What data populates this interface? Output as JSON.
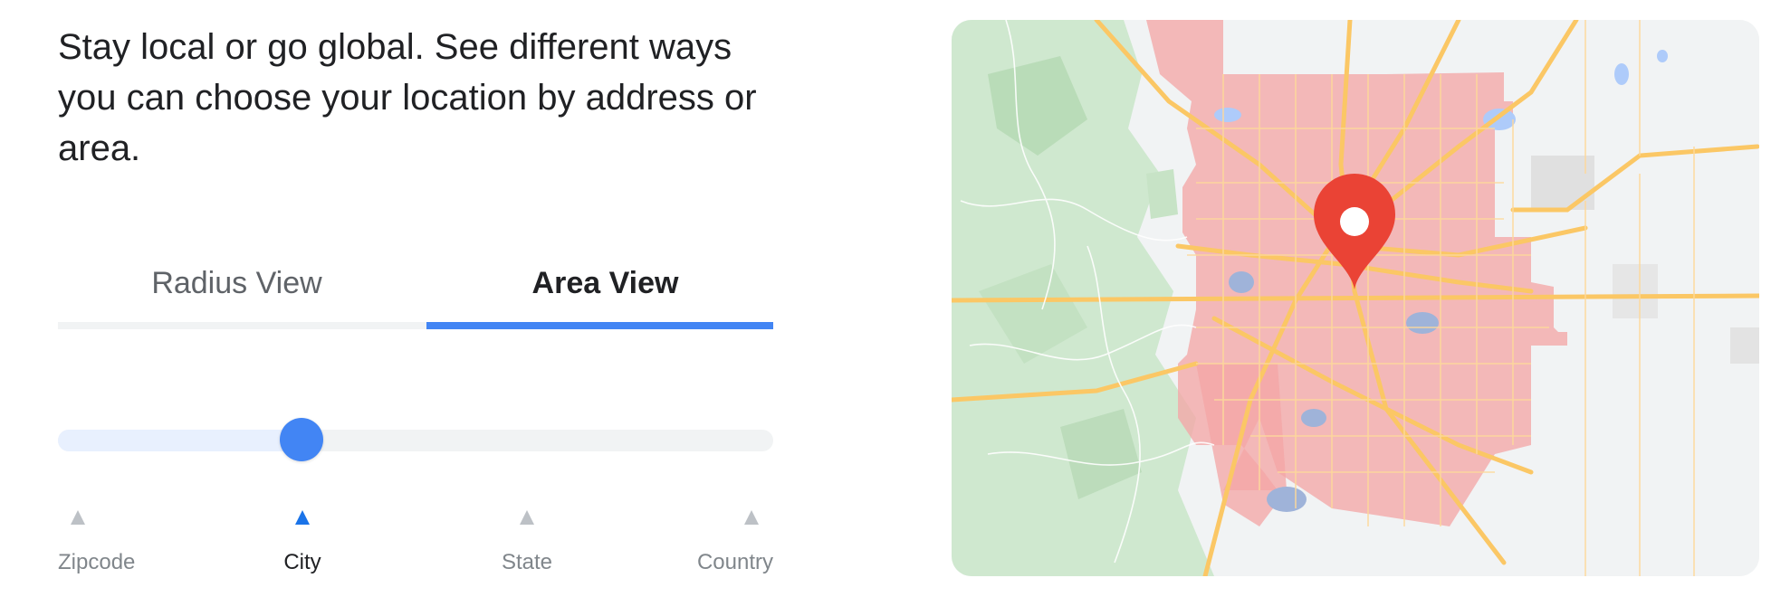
{
  "intro": {
    "text": "Stay local or go global. See different ways you can choose your location by address or area."
  },
  "tabs": [
    {
      "label": "Radius View",
      "selected": false
    },
    {
      "label": "Area View",
      "selected": true
    }
  ],
  "slider": {
    "value_fraction": 0.34,
    "stops": [
      {
        "label": "Zipcode",
        "active": false
      },
      {
        "label": "City",
        "active": true
      },
      {
        "label": "State",
        "active": false
      },
      {
        "label": "Country",
        "active": false
      }
    ]
  },
  "map": {
    "pin_icon": "map-pin-icon",
    "area_color": "#f4a7a7",
    "pin_color": "#ea4335",
    "accent_color": "#4285f4"
  }
}
